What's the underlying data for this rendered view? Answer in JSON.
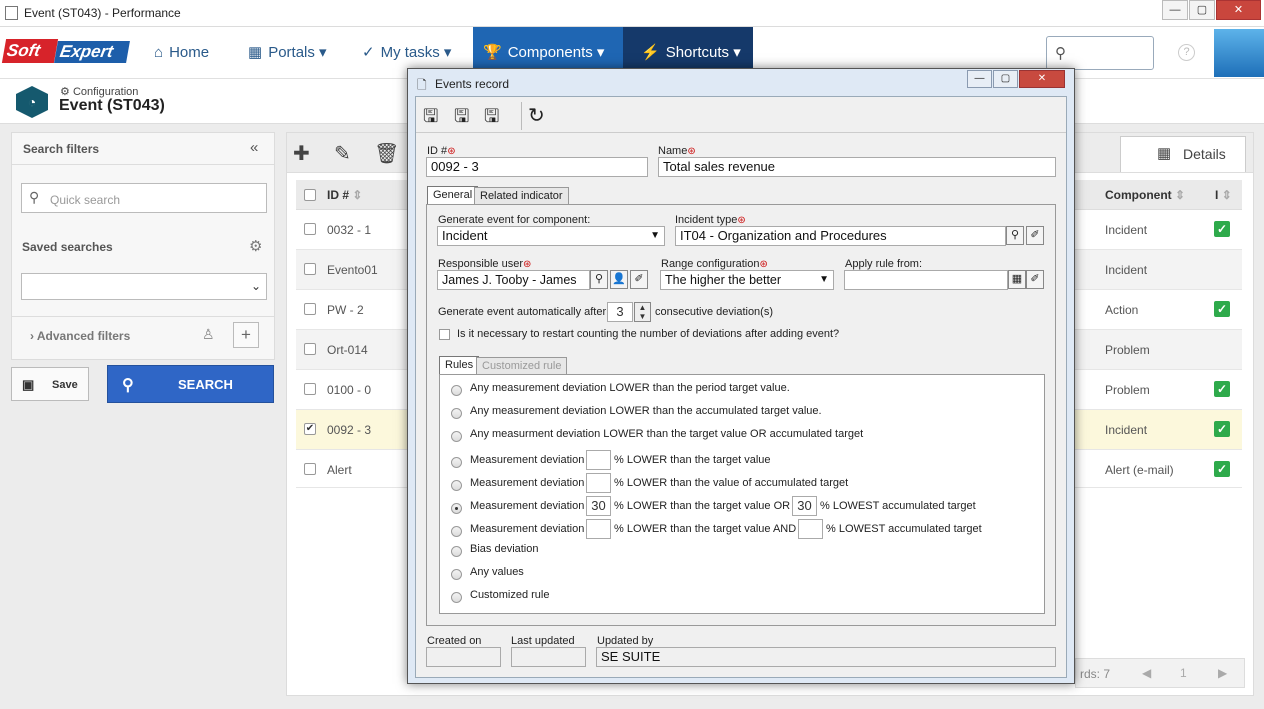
{
  "window": {
    "title": "Event (ST043) - Performance"
  },
  "nav": {
    "home": "Home",
    "portals": "Portals",
    "mytasks": "My tasks",
    "components": "Components",
    "shortcuts": "Shortcuts"
  },
  "brand": {
    "soft": "Soft",
    "expert": "Expert"
  },
  "header": {
    "config": "Configuration",
    "title": "Event (ST043)"
  },
  "filters": {
    "title": "Search filters",
    "quick_search_placeholder": "Quick search",
    "saved_searches": "Saved searches",
    "advanced": "Advanced filters",
    "save": "Save",
    "search": "SEARCH"
  },
  "grid": {
    "details_tab": "Details",
    "headers": {
      "id": "ID #",
      "component": "Component",
      "i": "I"
    },
    "rows": [
      {
        "id": "0032 - 1",
        "component": "Incident",
        "checked": false,
        "flag": true
      },
      {
        "id": "Evento01",
        "component": "Incident",
        "checked": false,
        "flag": false
      },
      {
        "id": "PW - 2",
        "component": "Action",
        "checked": false,
        "flag": true
      },
      {
        "id": "Ort-014",
        "component": "Problem",
        "checked": false,
        "flag": false
      },
      {
        "id": "0100 - 0",
        "component": "Problem",
        "checked": false,
        "flag": true
      },
      {
        "id": "0092 - 3",
        "component": "Incident",
        "checked": true,
        "flag": true
      },
      {
        "id": "Alert",
        "component": "Alert (e-mail)",
        "checked": false,
        "flag": true
      }
    ],
    "records": "rds: 7",
    "page": "1"
  },
  "modal": {
    "title": "Events record",
    "id_label": "ID #",
    "id_value": "0092 - 3",
    "name_label": "Name",
    "name_value": "Total sales revenue",
    "tabs": {
      "general": "General",
      "related": "Related indicator"
    },
    "gen_component_label": "Generate event for component:",
    "gen_component_value": "Incident",
    "incident_type_label": "Incident type",
    "incident_type_value": "IT04 - Organization and Procedures",
    "resp_user_label": "Responsible user",
    "resp_user_value": "James J. Tooby - James",
    "range_label": "Range configuration",
    "range_value": "The higher the better",
    "apply_rule_label": "Apply rule from:",
    "auto_after_label": "Generate event automatically after",
    "auto_after_value": "3",
    "consecutive_label": "consecutive deviation(s)",
    "restart_label": "Is it necessary to restart counting the number of deviations after adding event?",
    "rules_tabs": {
      "rules": "Rules",
      "custom": "Customized rule"
    },
    "rules": {
      "r1": "Any measurement deviation LOWER than the period target value.",
      "r2": "Any measurement deviation LOWER than the accumulated target value.",
      "r3": "Any measurment deviation LOWER than the target value OR accumulated target",
      "r4a": "Measurement deviation",
      "r4b": "% LOWER than the target value",
      "r5a": "Measurement deviation",
      "r5b": "% LOWER than the value of accumulated target",
      "r6a": "Measurement deviation",
      "r6b": "% LOWER than the target value OR",
      "r6v1": "30",
      "r6v2": "30",
      "r6c": "% LOWEST accumulated target",
      "r7a": "Measurement deviation",
      "r7b": "% LOWER than the target value AND",
      "r7c": "% LOWEST accumulated target",
      "r8": "Bias deviation",
      "r9": "Any values",
      "r10": "Customized rule"
    },
    "created_on_label": "Created on",
    "last_updated_label": "Last updated",
    "updated_by_label": "Updated by",
    "updated_by_value": "SE SUITE"
  }
}
